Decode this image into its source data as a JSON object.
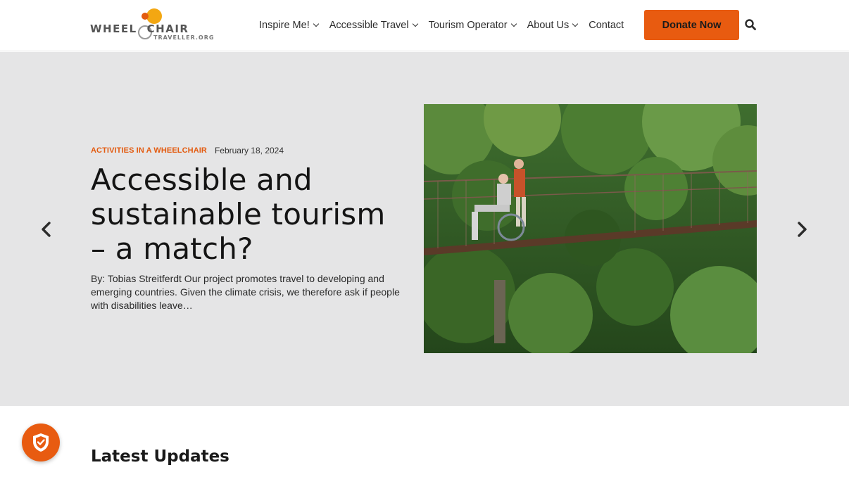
{
  "logo": {
    "main_left": "WHEEL",
    "main_right": "CHAIR",
    "sub": "TRAVELLER.ORG"
  },
  "nav": {
    "items": [
      {
        "label": "Inspire Me!",
        "has_dropdown": true
      },
      {
        "label": "Accessible Travel",
        "has_dropdown": true
      },
      {
        "label": "Tourism Operator",
        "has_dropdown": true
      },
      {
        "label": "About Us",
        "has_dropdown": true
      },
      {
        "label": "Contact",
        "has_dropdown": false
      }
    ],
    "donate_label": "Donate Now",
    "search_icon": "search-icon"
  },
  "hero": {
    "category": "ACTIVITIES IN A WHEELCHAIR",
    "date": "February 18, 2024",
    "title": "Accessible and sustainable tourism – a match?",
    "excerpt": "By: Tobias Streitferdt Our project promotes travel to developing and emerging countries. Given the climate crisis, we therefore ask if people with disabilities leave…",
    "prev_icon": "chevron-left-icon",
    "next_icon": "chevron-right-icon"
  },
  "latest": {
    "heading": "Latest Updates"
  },
  "colors": {
    "accent": "#e85b10",
    "hero_bg": "#e5e5e6",
    "text": "#141414"
  },
  "floating": {
    "icon": "shield-check-icon"
  }
}
